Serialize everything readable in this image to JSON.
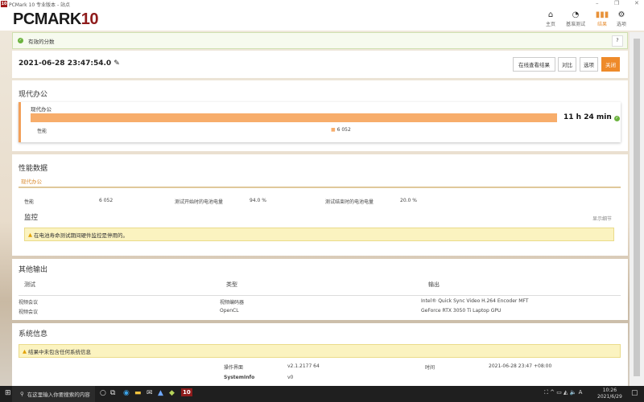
{
  "window": {
    "title": "PCMark 10 专业版本 - 站点",
    "logo": "10"
  },
  "brand": {
    "name": "PCMARK",
    "number": "10"
  },
  "nav": [
    {
      "label": "主页",
      "icon": "home-icon"
    },
    {
      "label": "基准测试",
      "icon": "gauge-icon"
    },
    {
      "label": "结果",
      "icon": "bar-chart-icon"
    },
    {
      "label": "选项",
      "icon": "gear-icon"
    }
  ],
  "valid": {
    "text": "有效的分数",
    "help": "?"
  },
  "result": {
    "date": "2021-06-28 23:47:54.0",
    "buttons": {
      "online": "在线查看结果",
      "compare": "对比",
      "options": "选项",
      "close": "关闭"
    }
  },
  "summary": {
    "section_title": "现代办公",
    "card_title": "现代办公",
    "duration": "11 h 24 min",
    "perf_label": "性能",
    "perf_value": "6 052",
    "bar_fill_percent": 100
  },
  "perf_data": {
    "title": "性能数据",
    "tab": "现代办公",
    "rows": [
      {
        "label": "性能",
        "value": "6 052"
      },
      {
        "label": "测试开始时的电池电量",
        "value": "94.0 %"
      },
      {
        "label": "测试结束时的电池电量",
        "value": "20.0 %"
      }
    ],
    "monitor_title": "监控",
    "show_details": "显示细节",
    "warning": "在电池寿命测试期间硬件监控是停用的。"
  },
  "other_output": {
    "title": "其他输出",
    "headers": [
      "测试",
      "类型",
      "输出"
    ],
    "rows": [
      [
        "视频会议",
        "视频编码器",
        "Intel® Quick Sync Video H.264 Encoder MFT"
      ],
      [
        "视频会议",
        "OpenCL",
        "GeForce RTX 3050 Ti Laptop GPU"
      ]
    ]
  },
  "system_info": {
    "title": "系统信息",
    "warning": "结果中未包含任何系统信息",
    "ui_label": "操作界面",
    "ui_value": "v2.1.2177 64",
    "time_label": "时间",
    "time_value": "2021-06-28 23:47 +08:00",
    "si_label": "SystemInfo",
    "si_value": "v0"
  },
  "taskbar": {
    "search_placeholder": "在这里输入你要搜索的内容",
    "time": "10:26",
    "date": "2021/6/29",
    "pcmark_icon": "10"
  },
  "colors": {
    "accent": "#e8923a",
    "bar": "#f7ad6b",
    "brand_red": "#8f1b1b",
    "valid_green": "#6cb33f"
  }
}
